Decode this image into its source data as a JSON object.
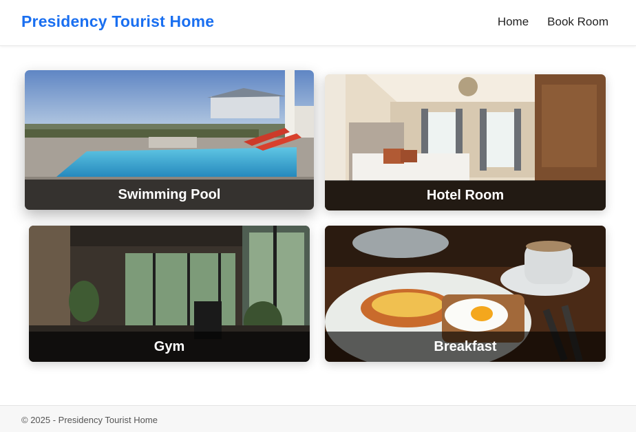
{
  "navbar": {
    "brand": "Presidency Tourist Home",
    "links": [
      "Home",
      "Book Room"
    ]
  },
  "cards": [
    {
      "label": "Swimming Pool"
    },
    {
      "label": "Hotel Room"
    },
    {
      "label": "Gym"
    },
    {
      "label": "Breakfast"
    }
  ],
  "footer": {
    "text": "© 2025 - Presidency Tourist Home"
  },
  "colors": {
    "brand": "#1a6ff0"
  }
}
